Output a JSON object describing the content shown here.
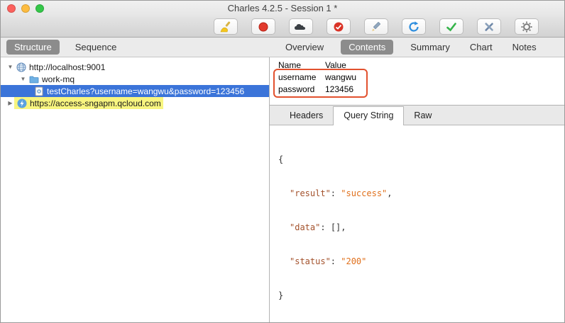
{
  "window": {
    "title": "Charles 4.2.5 - Session 1 *"
  },
  "toolbar": {
    "buttons": [
      {
        "name": "clear-session",
        "icon": "broom-icon"
      },
      {
        "name": "record",
        "icon": "record-icon"
      },
      {
        "name": "throttle",
        "icon": "throttle-icon"
      },
      {
        "name": "breakpoints",
        "icon": "breakpoints-icon"
      },
      {
        "name": "compose",
        "icon": "pencil-icon"
      },
      {
        "name": "repeat",
        "icon": "repeat-icon"
      },
      {
        "name": "validate",
        "icon": "check-icon"
      },
      {
        "name": "tools",
        "icon": "tools-icon"
      },
      {
        "name": "settings",
        "icon": "gear-icon"
      }
    ]
  },
  "left_panel": {
    "tabs": [
      {
        "label": "Structure",
        "selected": true
      },
      {
        "label": "Sequence",
        "selected": false
      }
    ],
    "tree": [
      {
        "label": "http://localhost:9001",
        "icon": "globe-icon",
        "state": "expanded",
        "selected": false,
        "highlighted": false
      },
      {
        "label": "work-mq",
        "icon": "folder-icon",
        "state": "expanded",
        "selected": false,
        "highlighted": false
      },
      {
        "label": "testCharles?username=wangwu&password=123456",
        "icon": "request-icon",
        "state": "leaf",
        "selected": true,
        "highlighted": false
      },
      {
        "label": "https://access-sngapm.qcloud.com",
        "icon": "bolt-icon",
        "state": "collapsed",
        "selected": false,
        "highlighted": true
      }
    ]
  },
  "right_panel": {
    "tabs": [
      {
        "label": "Overview",
        "selected": false
      },
      {
        "label": "Contents",
        "selected": true
      },
      {
        "label": "Summary",
        "selected": false
      },
      {
        "label": "Chart",
        "selected": false
      },
      {
        "label": "Notes",
        "selected": false
      }
    ],
    "query_table": {
      "columns": [
        "Name",
        "Value"
      ],
      "rows": [
        {
          "name": "username",
          "value": "wangwu"
        },
        {
          "name": "password",
          "value": "123456"
        }
      ],
      "annotation_color": "#e2512e"
    },
    "bottom_tabs": [
      {
        "label": "Headers",
        "selected": false
      },
      {
        "label": "Query String",
        "selected": true
      },
      {
        "label": "Raw",
        "selected": false
      }
    ],
    "response_body": {
      "open": "{",
      "close": "}",
      "entries": [
        {
          "key": "\"result\"",
          "sep": ": ",
          "value": "\"success\"",
          "tail": ","
        },
        {
          "key": "\"data\"",
          "sep": ": ",
          "value": "",
          "tail": "[],"
        },
        {
          "key": "\"status\"",
          "sep": ": ",
          "value": "\"200\"",
          "tail": ""
        }
      ],
      "key_color": "#a3512b",
      "string_color": "#e0701c"
    }
  }
}
